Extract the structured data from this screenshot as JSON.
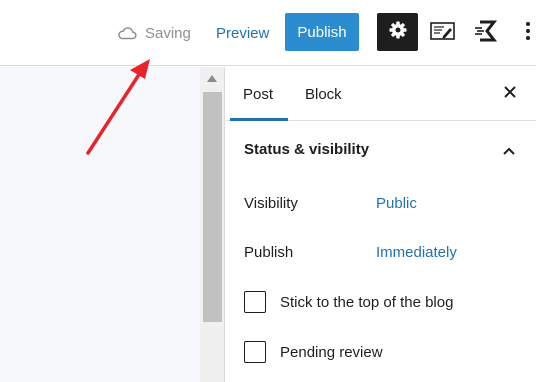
{
  "toolbar": {
    "saving_label": "Saving",
    "preview_label": "Preview",
    "publish_label": "Publish",
    "icons": [
      "cloud-icon",
      "gear-icon",
      "code-editor-icon",
      "plugin-logo-icon",
      "more-options-icon"
    ]
  },
  "sidebar": {
    "tabs": [
      {
        "label": "Post",
        "active": true
      },
      {
        "label": "Block",
        "active": false
      }
    ],
    "panel": {
      "title": "Status & visibility",
      "expanded": true,
      "rows": [
        {
          "label": "Visibility",
          "value": "Public"
        },
        {
          "label": "Publish",
          "value": "Immediately"
        }
      ],
      "checkboxes": [
        {
          "label": "Stick to the top of the blog",
          "checked": false
        },
        {
          "label": "Pending review",
          "checked": false
        }
      ]
    }
  },
  "colors": {
    "accent": "#2271b1",
    "publish_button": "#2b8ccf",
    "settings_active": "#1e1e1e",
    "annotation_arrow": "#e8232a"
  }
}
